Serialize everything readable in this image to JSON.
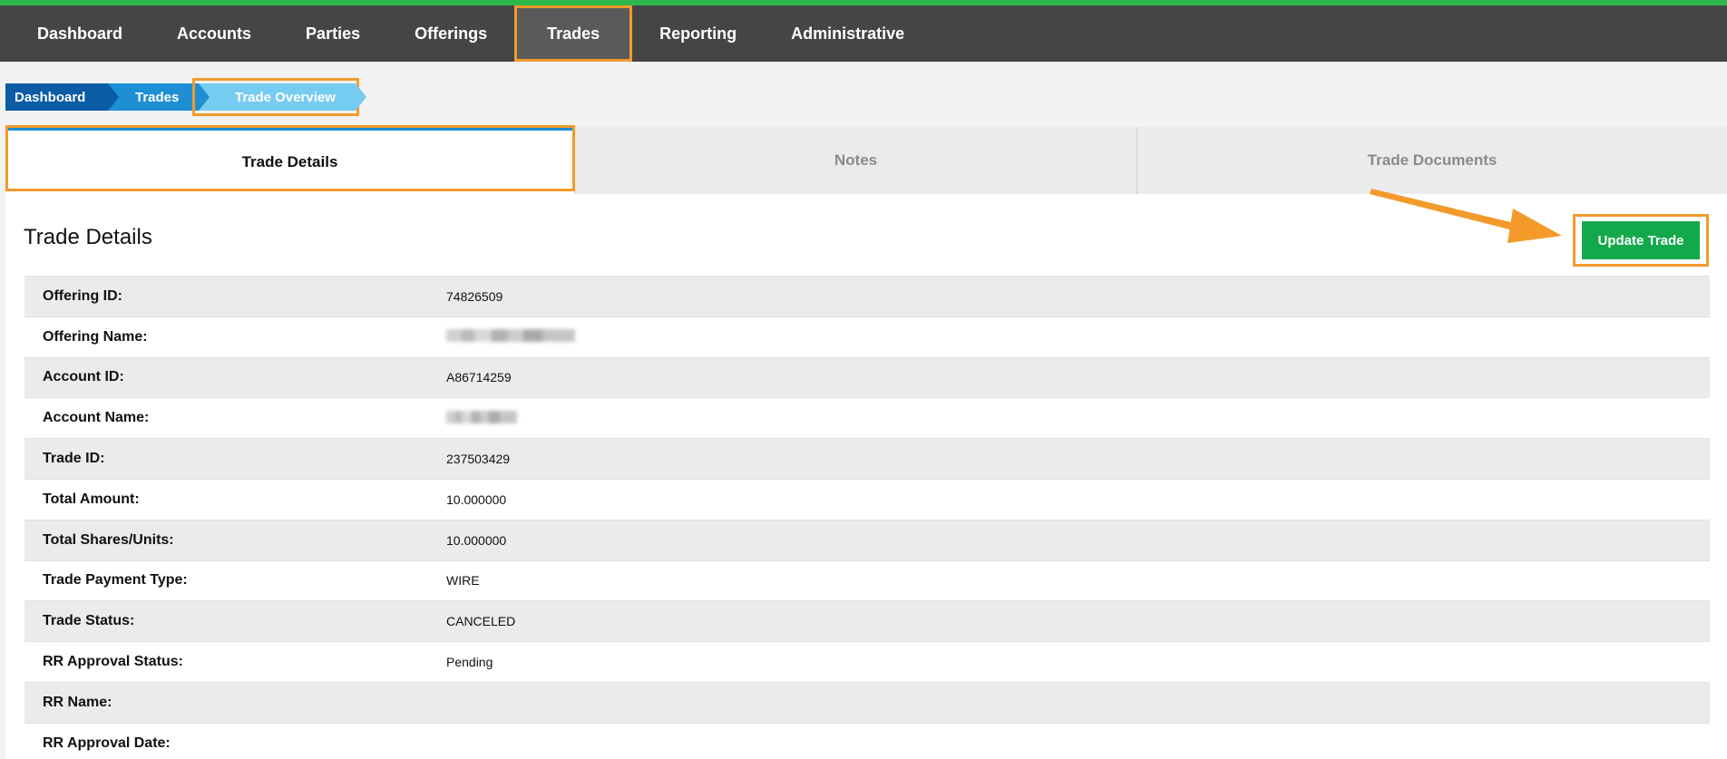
{
  "nav": {
    "items": [
      {
        "label": "Dashboard",
        "active": false
      },
      {
        "label": "Accounts",
        "active": false
      },
      {
        "label": "Parties",
        "active": false
      },
      {
        "label": "Offerings",
        "active": false
      },
      {
        "label": "Trades",
        "active": true
      },
      {
        "label": "Reporting",
        "active": false
      },
      {
        "label": "Administrative",
        "active": false
      }
    ]
  },
  "breadcrumb": [
    "Dashboard",
    "Trades",
    "Trade Overview"
  ],
  "tabs": [
    {
      "label": "Trade Details",
      "active": true
    },
    {
      "label": "Notes",
      "active": false
    },
    {
      "label": "Trade Documents",
      "active": false
    }
  ],
  "panel": {
    "title": "Trade Details",
    "update_button": "Update Trade"
  },
  "details": [
    {
      "label": "Offering ID:",
      "value": "74826509"
    },
    {
      "label": "Offering Name:",
      "value": "",
      "redacted": true
    },
    {
      "label": "Account ID:",
      "value": "A86714259"
    },
    {
      "label": "Account Name:",
      "value": "",
      "redacted": true
    },
    {
      "label": "Trade ID:",
      "value": "237503429"
    },
    {
      "label": "Total Amount:",
      "value": "10.000000"
    },
    {
      "label": "Total Shares/Units:",
      "value": "10.000000"
    },
    {
      "label": "Trade Payment Type:",
      "value": "WIRE"
    },
    {
      "label": "Trade Status:",
      "value": "CANCELED"
    },
    {
      "label": "RR Approval Status:",
      "value": "Pending"
    },
    {
      "label": "RR Name:",
      "value": ""
    },
    {
      "label": "RR Approval Date:",
      "value": ""
    }
  ],
  "colors": {
    "accent_green": "#13a94b",
    "highlight_orange": "#f39a2b",
    "nav_bg": "#454545",
    "tab_active_bar": "#1e8fd3"
  }
}
